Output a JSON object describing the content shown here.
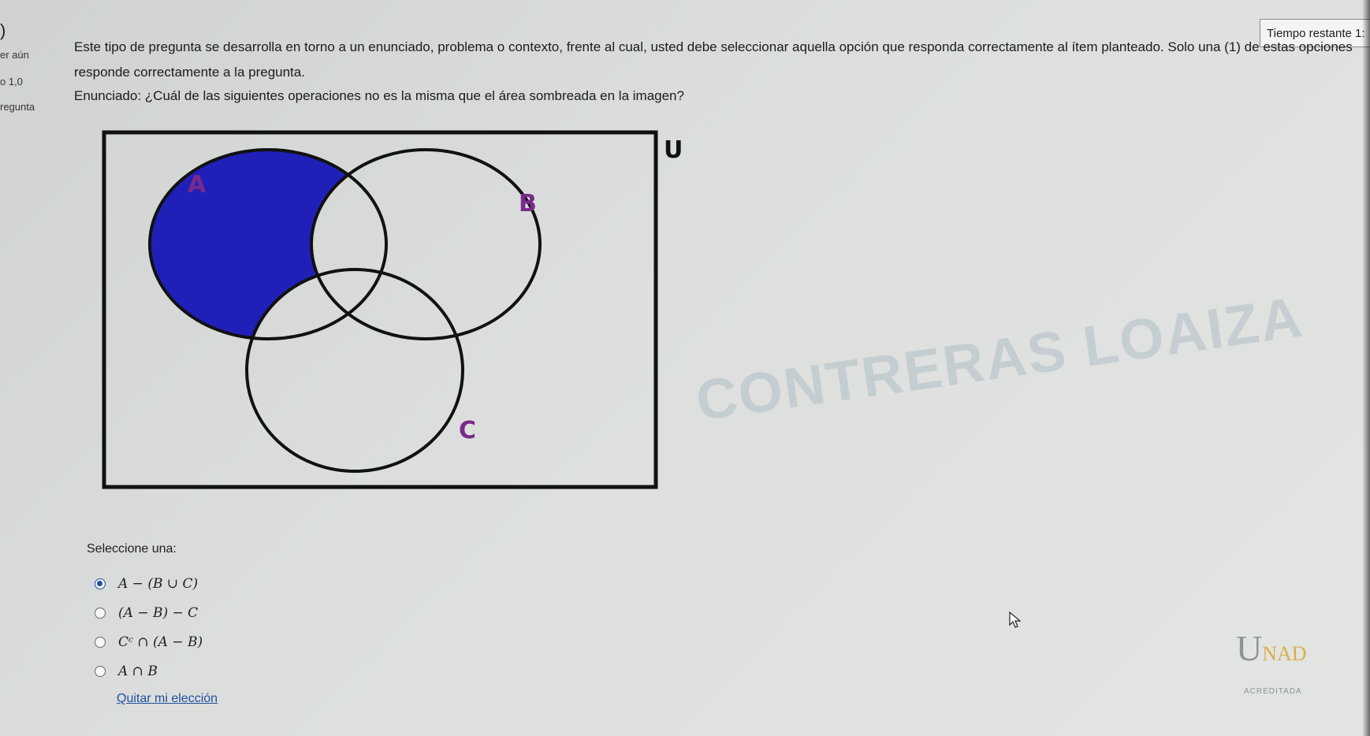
{
  "sidebar": {
    "bracket": ")",
    "status": "er aún",
    "mark": "o 1,0",
    "flag": "regunta"
  },
  "timer": {
    "label": "Tiempo restante 1:"
  },
  "question": {
    "intro_line1": "Este tipo de pregunta se desarrolla en torno a un enunciado, problema o contexto, frente al cual, usted debe seleccionar aquella opción que responda correctamente al ítem planteado. Solo una (1) de estas opciones",
    "intro_line2": "responde correctamente a la pregunta.",
    "statement": "Enunciado: ¿Cuál de las siguientes operaciones no es la misma que el área sombreada en la imagen?"
  },
  "diagram": {
    "universe_label": "U",
    "set_a_label": "A",
    "set_b_label": "B",
    "set_c_label": "C",
    "shade_color": "#2020b8",
    "label_color": "#7a2a8a"
  },
  "watermark": "CONTRERAS LOAIZA",
  "answer": {
    "select_label": "Seleccione una:",
    "options": [
      {
        "text": "A − (B ∪ C)",
        "selected": true
      },
      {
        "text": "(A − B) − C",
        "selected": false
      },
      {
        "text": "Cᶜ ∩ (A − B)",
        "selected": false
      },
      {
        "text": "A ∩ B",
        "selected": false
      }
    ],
    "clear_label": "Quitar mi elección"
  },
  "logo": {
    "main": "UNAD",
    "sub": "ACREDITADA"
  }
}
